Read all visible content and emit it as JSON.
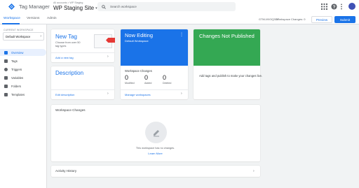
{
  "app": {
    "title": "Tag Manager",
    "breadcrumb": "All accounts > WP Staging",
    "container_name": "WP Staging Site",
    "search_placeholder": "Search workspace"
  },
  "tabs": [
    {
      "label": "Workspace",
      "active": true
    },
    {
      "label": "Versions",
      "active": false
    },
    {
      "label": "Admin",
      "active": false
    }
  ],
  "toolbar": {
    "container_id": "GTM-MV3Q3D7",
    "workspace_changes": "Workspace Changes: 0",
    "preview_label": "Preview",
    "submit_label": "Submit"
  },
  "sidebar": {
    "current_workspace_label": "CURRENT WORKSPACE",
    "workspace_name": "Default Workspace",
    "items": [
      {
        "label": "Overview",
        "icon": "overview-icon",
        "active": true
      },
      {
        "label": "Tags",
        "icon": "tag-icon",
        "active": false
      },
      {
        "label": "Triggers",
        "icon": "trigger-icon",
        "active": false
      },
      {
        "label": "Variables",
        "icon": "variable-icon",
        "active": false
      },
      {
        "label": "Folders",
        "icon": "folder-icon",
        "active": false
      },
      {
        "label": "Templates",
        "icon": "template-icon",
        "active": false
      }
    ]
  },
  "new_tag": {
    "title": "New Tag",
    "description": "Choose from over 50 tag types",
    "link": "Add a new tag"
  },
  "description_card": {
    "title": "Description",
    "link": "Edit description"
  },
  "now_editing": {
    "title": "Now Editing",
    "workspace": "Default Workspace",
    "changes_label": "Workspace Changes",
    "counts": [
      {
        "value": "0",
        "label": "Modified"
      },
      {
        "value": "0",
        "label": "Added"
      },
      {
        "value": "0",
        "label": "Deleted"
      }
    ],
    "link": "Manage workspaces"
  },
  "not_published": {
    "title": "Changes Not Published",
    "description": "Add tags and publish to make your changes live."
  },
  "workspace_changes": {
    "title": "Workspace Changes",
    "empty_text": "This workspace has no changes.",
    "learn_more": "Learn More"
  },
  "activity_history": {
    "title": "Activity History"
  },
  "colors": {
    "accent": "#1a73e8",
    "success": "#34a853",
    "tag_badge": "#e53935"
  }
}
